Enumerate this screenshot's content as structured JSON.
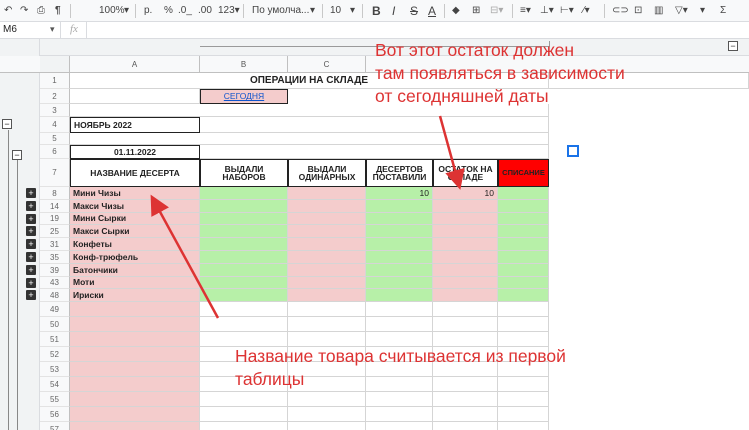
{
  "toolbar": {
    "zoom": "100%",
    "currency": "р.",
    "percent": "%",
    "dec_less": ".0_",
    "dec_more": ".00",
    "format": "123▾",
    "font": "По умолча...",
    "font_size": "10",
    "bold": "B",
    "italic": "I",
    "strike": "S",
    "text_color": "A"
  },
  "formula_bar": {
    "cell_ref": "M6",
    "fx": "fx"
  },
  "columns": [
    "A",
    "B",
    "C"
  ],
  "title": "ОПЕРАЦИИ НА СКЛАДЕ",
  "today_link": "СЕГОДНЯ",
  "month_label": "НОЯБРЬ 2022",
  "date_label": "01.11.2022",
  "headers": {
    "name": "НАЗВАНИЕ ДЕСЕРТА",
    "sets": "ВЫДАЛИ НАБОРОВ",
    "single": "ВЫДАЛИ ОДИНАРНЫХ",
    "supplied": "ДЕСЕРТОВ ПОСТАВИЛИ",
    "balance": "ОСТАТОК НА СКЛАДЕ",
    "writeoff": "СПИСАНИЕ"
  },
  "row_numbers_top": [
    "1",
    "2",
    "3",
    "4",
    "5",
    "6",
    "7"
  ],
  "items": [
    {
      "row": "8",
      "name": "Мини Чизы",
      "supplied": "10",
      "balance": "10"
    },
    {
      "row": "14",
      "name": "Макси Чизы",
      "supplied": "",
      "balance": ""
    },
    {
      "row": "19",
      "name": "Мини Сырки",
      "supplied": "",
      "balance": ""
    },
    {
      "row": "25",
      "name": "Макси Сырки",
      "supplied": "",
      "balance": ""
    },
    {
      "row": "31",
      "name": "Конфеты",
      "supplied": "",
      "balance": ""
    },
    {
      "row": "35",
      "name": "Конф-трюфель",
      "supplied": "",
      "balance": ""
    },
    {
      "row": "39",
      "name": "Батончики",
      "supplied": "",
      "balance": ""
    },
    {
      "row": "43",
      "name": "Моти",
      "supplied": "",
      "balance": ""
    },
    {
      "row": "48",
      "name": "Ириски",
      "supplied": "",
      "balance": ""
    }
  ],
  "empty_rows": [
    "49",
    "50",
    "51",
    "52",
    "53",
    "54",
    "55",
    "56",
    "57"
  ],
  "annotations": {
    "top_1": "Вот этот остаток должен",
    "top_2": "там появляться в зависимости",
    "top_3": "от сегодняшней даты",
    "bottom_1": "Название товара считывается из первой",
    "bottom_2": "таблицы"
  },
  "colors": {
    "pink": "#f4cccc",
    "green": "#b7f0a8",
    "red_header": "#ff0000",
    "annotation": "#dd3333",
    "link": "#1155cc"
  }
}
